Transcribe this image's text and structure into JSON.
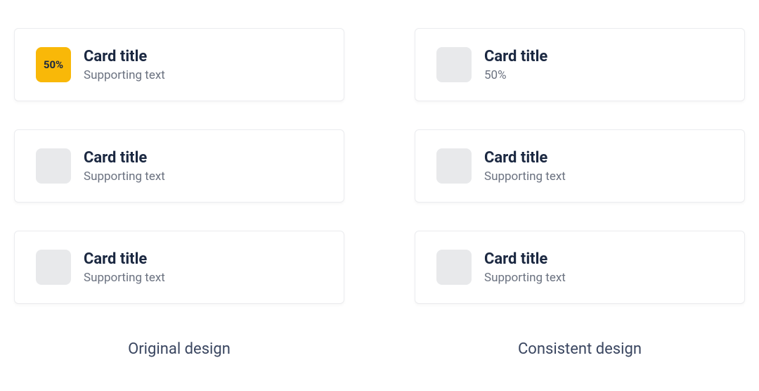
{
  "left": {
    "caption": "Original design",
    "cards": [
      {
        "title": "Card title",
        "subtitle": "Supporting text",
        "badgeType": "orange",
        "badgeText": "50%"
      },
      {
        "title": "Card title",
        "subtitle": "Supporting text",
        "badgeType": "gray",
        "badgeText": ""
      },
      {
        "title": "Card title",
        "subtitle": "Supporting text",
        "badgeType": "gray",
        "badgeText": ""
      }
    ]
  },
  "right": {
    "caption": "Consistent design",
    "cards": [
      {
        "title": "Card title",
        "subtitle": "50%",
        "badgeType": "gray",
        "badgeText": ""
      },
      {
        "title": "Card title",
        "subtitle": "Supporting text",
        "badgeType": "gray",
        "badgeText": ""
      },
      {
        "title": "Card title",
        "subtitle": "Supporting text",
        "badgeType": "gray",
        "badgeText": ""
      }
    ]
  }
}
